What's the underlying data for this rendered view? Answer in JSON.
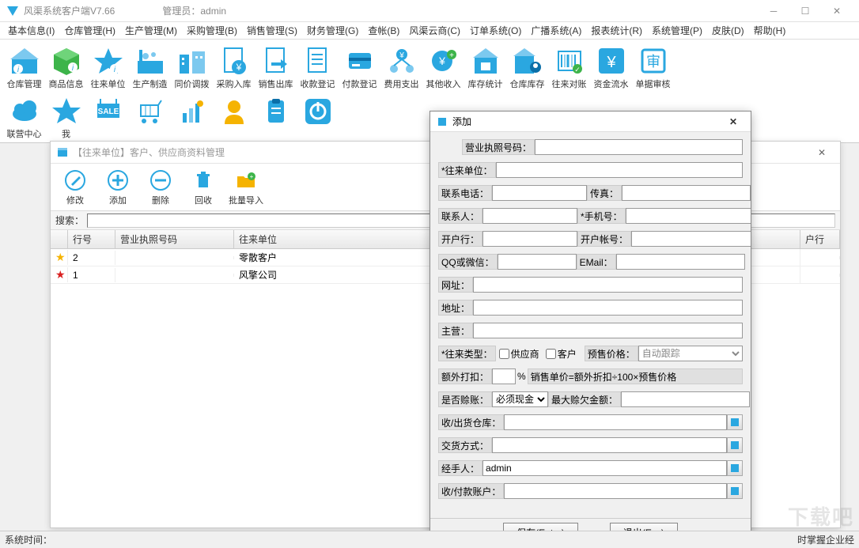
{
  "window": {
    "title": "风渠系统客户端V7.66",
    "admin_label": "管理员：admin"
  },
  "menu": [
    "基本信息(I)",
    "仓库管理(H)",
    "生产管理(M)",
    "采购管理(B)",
    "销售管理(S)",
    "财务管理(G)",
    "查帐(B)",
    "风渠云商(C)",
    "订单系统(O)",
    "广播系统(A)",
    "报表统计(R)",
    "系统管理(P)",
    "皮肤(D)",
    "帮助(H)"
  ],
  "toolbar_row1": [
    {
      "label": "仓库管理"
    },
    {
      "label": "商品信息"
    },
    {
      "label": "往来单位"
    },
    {
      "label": "生产制造"
    },
    {
      "label": "同价调拨"
    },
    {
      "label": "采购入库"
    },
    {
      "label": "销售出库"
    },
    {
      "label": "收款登记"
    },
    {
      "label": "付款登记"
    },
    {
      "label": "费用支出"
    },
    {
      "label": "其他收入"
    },
    {
      "label": "库存统计"
    },
    {
      "label": "仓库库存"
    },
    {
      "label": "往来对账"
    },
    {
      "label": "资金流水"
    },
    {
      "label": "单据审核"
    }
  ],
  "toolbar_row2": [
    {
      "label": "联营中心"
    },
    {
      "label": "我"
    }
  ],
  "subwindow": {
    "title": "【往来单位】客户、供应商资料管理",
    "toolbar": [
      {
        "label": "修改"
      },
      {
        "label": "添加"
      },
      {
        "label": "删除"
      },
      {
        "label": "回收"
      },
      {
        "label": "批量导入"
      }
    ],
    "search_label": "搜索：",
    "search_value": "",
    "columns": {
      "row": "行号",
      "lic": "营业执照号码",
      "unit": "往来单位",
      "right": "户行"
    },
    "rows": [
      {
        "star": "gold",
        "row": "2",
        "lic": "",
        "unit": "零散客户"
      },
      {
        "star": "red",
        "row": "1",
        "lic": "",
        "unit": "风擎公司"
      }
    ]
  },
  "dialog": {
    "title": "添加",
    "labels": {
      "lic": "营业执照号码：",
      "unit": "*往来单位：",
      "phone": "联系电话：",
      "fax": "传真：",
      "contact": "联系人：",
      "mobile": "*手机号：",
      "bank": "开户行：",
      "account": "开户帐号：",
      "qq": "QQ或微信：",
      "email": "EMail：",
      "url": "网址：",
      "addr": "地址：",
      "main": "主营：",
      "type": "*往来类型：",
      "type_supplier": "供应商",
      "type_customer": "客户",
      "presale": "预售价格：",
      "presale_value": "自动跟踪",
      "discount": "额外打扣：",
      "discount_unit": "%",
      "discount_formula": "销售单价=额外折扣÷100×预售价格",
      "credit": "是否赊账：",
      "credit_value": "必须现金",
      "max_debt": "最大赊欠金额：",
      "warehouse": "收/出货仓库：",
      "delivery": "交货方式：",
      "handler": "经手人：",
      "handler_value": "admin",
      "pay_account": "收/付款账户："
    },
    "buttons": {
      "save": "保存(Enter)",
      "exit": "退出(Esc)"
    }
  },
  "statusbar": {
    "time_label": "系统时间：",
    "footer": "时掌握企业经"
  },
  "watermark": "下载吧"
}
